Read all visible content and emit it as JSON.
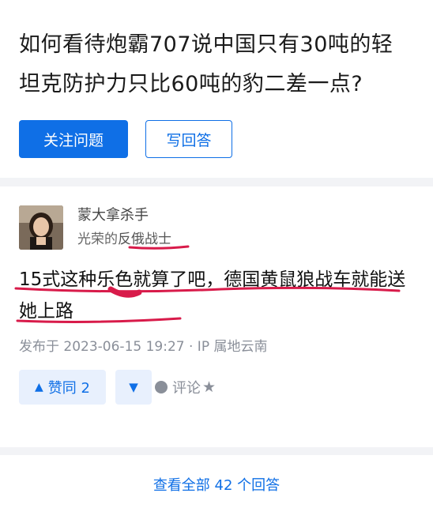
{
  "question": {
    "title": "如何看待炮霸707说中国只有30吨的轻坦克防护力只比60吨的豹二差一点?",
    "follow_label": "关注问题",
    "answer_label": "写回答"
  },
  "answer": {
    "author_name": "蒙大拿杀手",
    "author_badge_prefix": "光荣的",
    "author_badge_highlight": "反俄战士",
    "content": "15式这种乐色就算了吧，德国黄鼠狼战车就能送她上路",
    "meta": "发布于 2023-06-15 19:27 · IP 属地云南",
    "vote_label": "赞同 2",
    "comment_label": "评论",
    "icons": {
      "upvote": "triangle-up-icon",
      "downvote": "triangle-down-icon",
      "comment": "comment-icon",
      "favorite": "star-icon"
    }
  },
  "footer": {
    "view_all": "查看全部 42 个回答"
  },
  "colors": {
    "accent": "#0f6fe6",
    "annotation": "#d81b4a"
  }
}
